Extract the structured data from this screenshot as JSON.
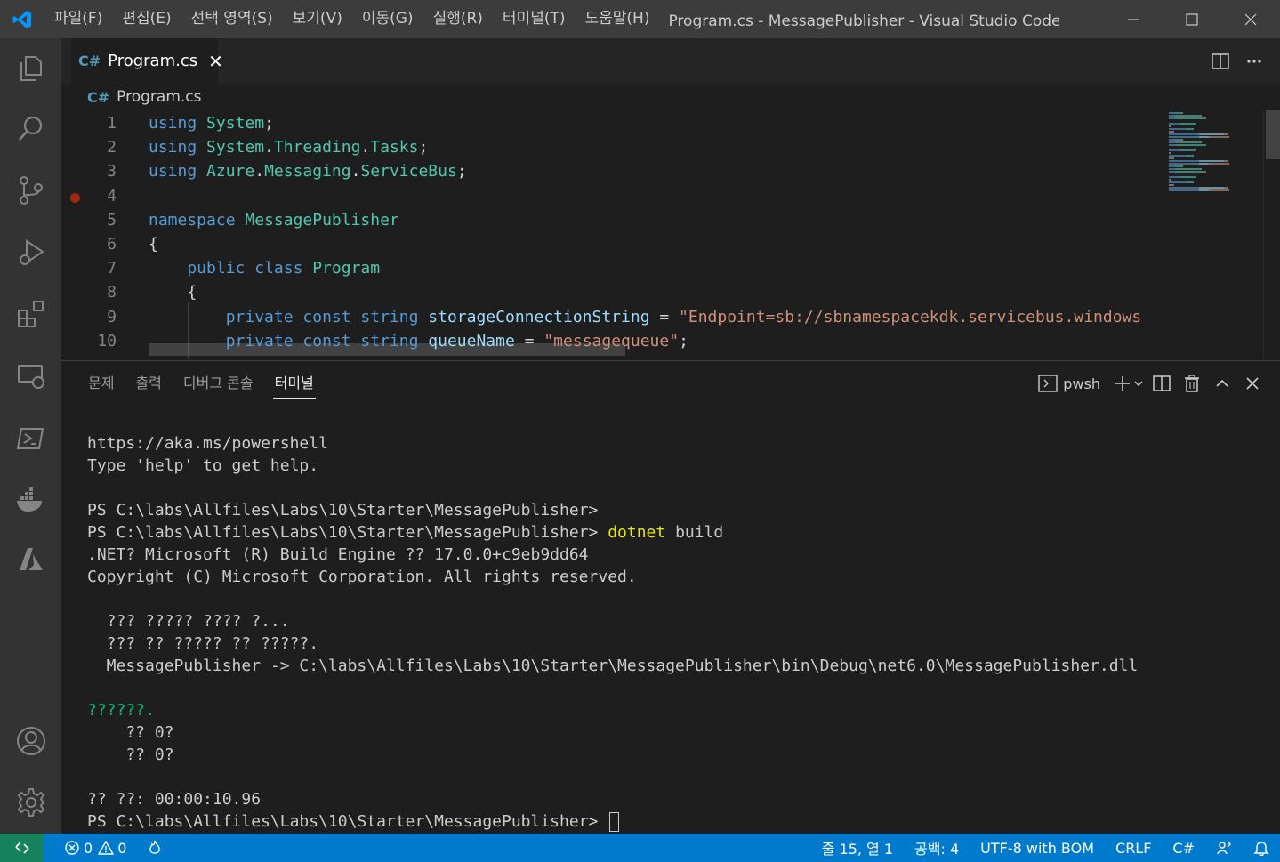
{
  "titlebar": {
    "menu": [
      "파일(F)",
      "편집(E)",
      "선택 영역(S)",
      "보기(V)",
      "이동(G)",
      "실행(R)",
      "터미널(T)",
      "도움말(H)"
    ],
    "title": "Program.cs - MessagePublisher - Visual Studio Code [관..."
  },
  "colors": {
    "accent": "#007acc",
    "remote": "#16825d",
    "keyword": "#569cd6",
    "type": "#4ec9b0",
    "string": "#ce9178"
  },
  "editor": {
    "tab_label": "Program.cs",
    "tab_icon": "C#",
    "breadcrumb": "Program.cs",
    "lines": [
      {
        "num": "1",
        "tokens": [
          {
            "t": "using ",
            "c": "kw"
          },
          {
            "t": "System",
            "c": "ty"
          },
          {
            "t": ";",
            "c": "pl"
          }
        ]
      },
      {
        "num": "2",
        "tokens": [
          {
            "t": "using ",
            "c": "kw"
          },
          {
            "t": "System",
            "c": "ty"
          },
          {
            "t": ".",
            "c": "pl"
          },
          {
            "t": "Threading",
            "c": "ty"
          },
          {
            "t": ".",
            "c": "pl"
          },
          {
            "t": "Tasks",
            "c": "ty"
          },
          {
            "t": ";",
            "c": "pl"
          }
        ]
      },
      {
        "num": "3",
        "tokens": [
          {
            "t": "using ",
            "c": "kw"
          },
          {
            "t": "Azure",
            "c": "ty"
          },
          {
            "t": ".",
            "c": "pl"
          },
          {
            "t": "Messaging",
            "c": "ty"
          },
          {
            "t": ".",
            "c": "pl"
          },
          {
            "t": "ServiceBus",
            "c": "ty"
          },
          {
            "t": ";",
            "c": "pl"
          }
        ]
      },
      {
        "num": "4",
        "tokens": []
      },
      {
        "num": "5",
        "tokens": [
          {
            "t": "namespace ",
            "c": "kw"
          },
          {
            "t": "MessagePublisher",
            "c": "ty"
          }
        ]
      },
      {
        "num": "6",
        "tokens": [
          {
            "t": "{",
            "c": "pl"
          }
        ]
      },
      {
        "num": "7",
        "tokens": [
          {
            "t": "    public ",
            "c": "kw"
          },
          {
            "t": "class ",
            "c": "kw"
          },
          {
            "t": "Program",
            "c": "ty"
          }
        ]
      },
      {
        "num": "8",
        "tokens": [
          {
            "t": "    {",
            "c": "pl"
          }
        ]
      },
      {
        "num": "9",
        "tokens": [
          {
            "t": "        private ",
            "c": "kw"
          },
          {
            "t": "const ",
            "c": "kw"
          },
          {
            "t": "string ",
            "c": "kw"
          },
          {
            "t": "storageConnectionString",
            "c": "id"
          },
          {
            "t": " = ",
            "c": "pl"
          },
          {
            "t": "\"Endpoint=sb://sbnamespacekdk.servicebus.windows",
            "c": "str"
          }
        ]
      },
      {
        "num": "10",
        "tokens": [
          {
            "t": "        private ",
            "c": "kw"
          },
          {
            "t": "const ",
            "c": "kw"
          },
          {
            "t": "string ",
            "c": "kw"
          },
          {
            "t": "queueName",
            "c": "id"
          },
          {
            "t": " = ",
            "c": "pl"
          },
          {
            "t": "\"messagequeue\"",
            "c": "str"
          },
          {
            "t": ";",
            "c": "pl"
          }
        ]
      }
    ]
  },
  "panel": {
    "tabs": [
      "문제",
      "출력",
      "디버그 콘솔",
      "터미널"
    ],
    "active_tab": "터미널",
    "shell": "pwsh",
    "terminal_lines": [
      {
        "text": "https://aka.ms/powershell",
        "style": ""
      },
      {
        "text": "Type 'help' to get help.",
        "style": ""
      },
      {
        "text": "",
        "style": ""
      },
      {
        "text": "PS C:\\labs\\Allfiles\\Labs\\10\\Starter\\MessagePublisher>",
        "style": ""
      },
      {
        "text": "PS C:\\labs\\Allfiles\\Labs\\10\\Starter\\MessagePublisher> ",
        "style": "",
        "cmd": "dotnet",
        "rest": " build"
      },
      {
        "text": ".NET? Microsoft (R) Build Engine ?? 17.0.0+c9eb9dd64",
        "style": ""
      },
      {
        "text": "Copyright (C) Microsoft Corporation. All rights reserved.",
        "style": ""
      },
      {
        "text": "",
        "style": ""
      },
      {
        "text": "  ??? ????? ???? ?...",
        "style": ""
      },
      {
        "text": "  ??? ?? ????? ?? ?????.",
        "style": ""
      },
      {
        "text": "  MessagePublisher -> C:\\labs\\Allfiles\\Labs\\10\\Starter\\MessagePublisher\\bin\\Debug\\net6.0\\MessagePublisher.dll",
        "style": ""
      },
      {
        "text": "",
        "style": ""
      },
      {
        "text": "??????.",
        "style": "green"
      },
      {
        "text": "    ?? 0?",
        "style": ""
      },
      {
        "text": "    ?? 0?",
        "style": ""
      },
      {
        "text": "",
        "style": ""
      },
      {
        "text": "?? ??: 00:00:10.96",
        "style": ""
      },
      {
        "text": "PS C:\\labs\\Allfiles\\Labs\\10\\Starter\\MessagePublisher> ",
        "style": "",
        "cursor": true
      }
    ]
  },
  "statusbar": {
    "errors": "0",
    "warnings": "0",
    "position": "줄 15, 열 1",
    "spaces": "공백: 4",
    "encoding": "UTF-8 with BOM",
    "eol": "CRLF",
    "language": "C#"
  }
}
